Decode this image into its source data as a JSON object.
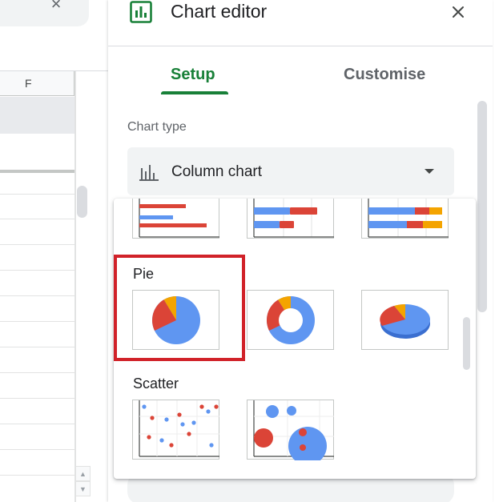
{
  "sheet": {
    "column_header": "F",
    "close_glyph": "×"
  },
  "editor": {
    "title": "Chart editor",
    "tabs": [
      {
        "label": "Setup",
        "selected": true
      },
      {
        "label": "Customise",
        "selected": false
      }
    ],
    "chart_type_label": "Chart type",
    "chart_type_value": "Column chart"
  },
  "dropdown": {
    "groups": [
      {
        "label": "",
        "items": [
          "bar-chart",
          "stacked-bar-chart",
          "100-stacked-bar-chart"
        ]
      },
      {
        "label": "Pie",
        "items": [
          "pie-chart",
          "doughnut-chart",
          "3d-pie-chart"
        ],
        "highlighted": "pie-chart"
      },
      {
        "label": "Scatter",
        "items": [
          "scatter-chart",
          "bubble-chart"
        ]
      }
    ]
  },
  "colors": {
    "accent_green": "#188038",
    "chart_blue": "#5f96f1",
    "chart_red": "#db4437",
    "chart_orange": "#f4a400",
    "highlight_red": "#d12229"
  },
  "icons": {
    "editor": "chart-editor-icon",
    "close": "close-icon",
    "chart_type": "column-chart-icon",
    "caret": "caret-down-icon"
  }
}
